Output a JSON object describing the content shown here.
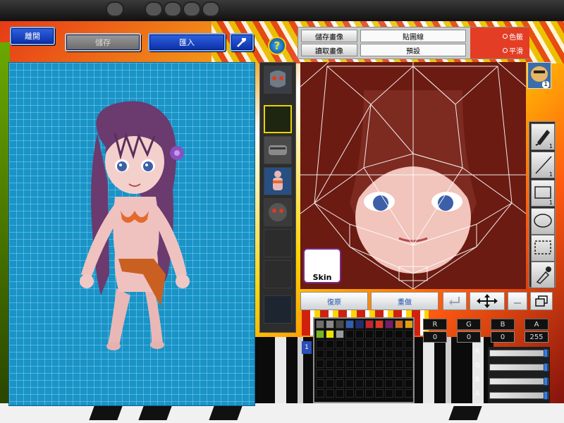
{
  "toolbar": {
    "leave_label": "離開",
    "save_label": "儲存",
    "import_label": "匯入",
    "help_label": "?"
  },
  "texture_panel": {
    "save_image_label": "儲存畫像",
    "load_image_label": "讀取畫像",
    "map_line_label": "貼圖線",
    "preset_label": "預設",
    "radio_color": "色籤",
    "radio_smooth": "平滑"
  },
  "edit": {
    "undo_label": "復原",
    "redo_label": "重做"
  },
  "tools": {
    "pen_count": "1",
    "line_count": "1",
    "rect_count": "1",
    "avatar_count": "1"
  },
  "rgb": {
    "r_label": "R",
    "g_label": "G",
    "b_label": "B",
    "a_label": "A",
    "r_value": "0",
    "g_value": "0",
    "b_value": "0",
    "a_value": "255"
  },
  "palette": {
    "tab_label": "1",
    "row1": [
      "#6e6e6e",
      "#8a8a8a",
      "#4a4a4a",
      "#2f5fb5",
      "#1b2f7a",
      "#c8232c",
      "#e03a1e",
      "#7a1a6a",
      "#d06a1a",
      "#e0a010"
    ],
    "row2": [
      "#7ab51a",
      "#f0e000",
      "#9a9a9a"
    ]
  },
  "skin_badge": "Skin"
}
